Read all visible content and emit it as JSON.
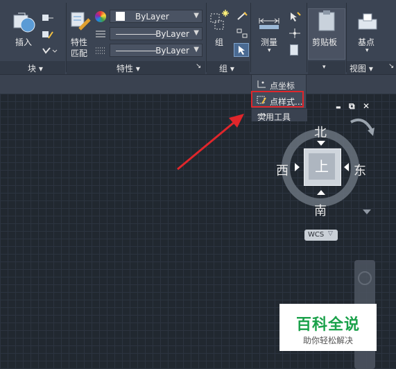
{
  "ribbon": {
    "block_panel": {
      "insert_label": "插入",
      "panel_title": "块 ▾"
    },
    "properties_panel": {
      "match_label_line1": "特性",
      "match_label_line2": "匹配",
      "color_value": "ByLayer",
      "linetype_value": "ByLayer",
      "lineweight_value": "ByLayer",
      "panel_title": "特性 ▾",
      "launcher": "↘"
    },
    "group_panel": {
      "group_label": "组",
      "panel_title": "组 ▾"
    },
    "utilities": {
      "measure_label": "测量",
      "measure_arrow": "▾"
    },
    "clipboard": {
      "paste_label": "剪贴板",
      "arrow": "▾"
    },
    "view_panel": {
      "base_label": "基点",
      "arrow": "▾",
      "panel_title": "视图 ▾",
      "launcher": "↘"
    }
  },
  "dropdown": {
    "items": [
      {
        "label": "点坐标",
        "icon": "point-coordinate-icon"
      },
      {
        "label": "点样式...",
        "icon": "point-style-icon",
        "highlighted": true
      },
      {
        "label": "实用工具",
        "icon": "utilities-icon"
      }
    ]
  },
  "viewcube": {
    "north": "北",
    "south": "南",
    "west": "西",
    "east": "东",
    "face": "上",
    "wcs_label": "WCS"
  },
  "window_controls": {
    "minimize": "▬",
    "restore": "⧉",
    "close": "✕"
  },
  "watermark": {
    "title": "百科全说",
    "subtitle": "助你轻松解决"
  },
  "colors": {
    "highlight_border": "#e0262b",
    "arrow": "#e0262b",
    "watermark_green": "#1aa14a"
  }
}
